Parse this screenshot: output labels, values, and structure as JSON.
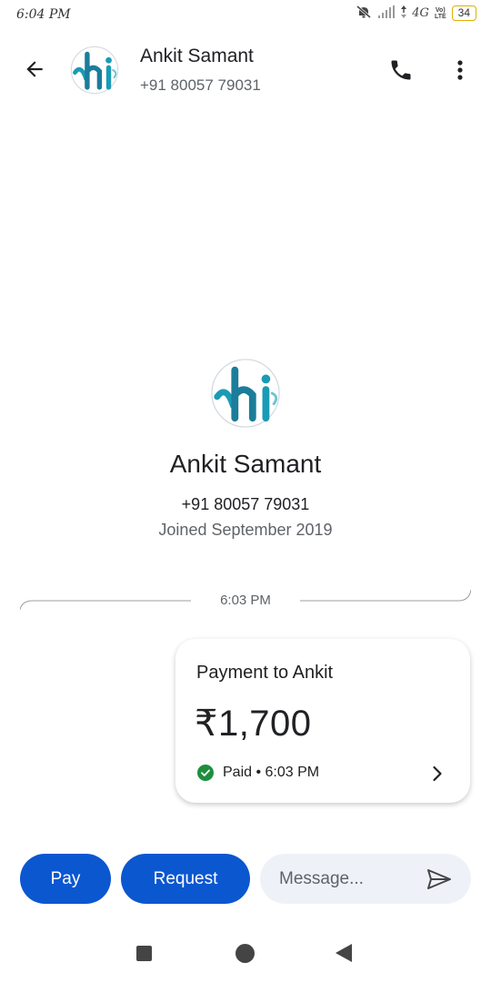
{
  "status_bar": {
    "time": "6:04 PM",
    "network": "4G",
    "volte_top": "Vo)",
    "volte_bottom": "LTE",
    "battery": "34",
    "icons": [
      "mute-icon",
      "signal-icon",
      "data-arrows-icon",
      "volte-icon",
      "battery-icon"
    ]
  },
  "header": {
    "contact_name": "Ankit Samant",
    "contact_phone": "+91 80057 79031",
    "icons": [
      "back-arrow-icon",
      "avatar-logo",
      "phone-icon",
      "more-vert-icon"
    ]
  },
  "profile": {
    "name": "Ankit Samant",
    "phone": "+91 80057 79031",
    "joined": "Joined September 2019",
    "avatar_text": "hi"
  },
  "timeline": {
    "divider_time": "6:03 PM"
  },
  "payment_card": {
    "title": "Payment to Ankit",
    "amount": "₹1,700",
    "status": "Paid • 6:03 PM",
    "status_color": "#1e8e3e"
  },
  "bottom_bar": {
    "pay_label": "Pay",
    "request_label": "Request",
    "message_placeholder": "Message...",
    "accent_color": "#0b57d0"
  },
  "nav_bar": {
    "icons": [
      "recents-icon",
      "home-icon",
      "back-icon"
    ]
  }
}
